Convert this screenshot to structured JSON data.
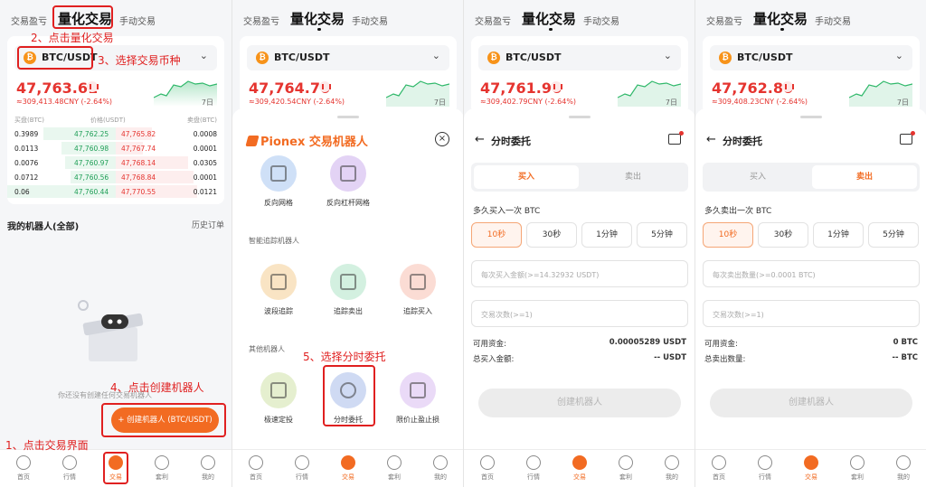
{
  "tabs": {
    "profit": "交易盈亏",
    "quant": "量化交易",
    "manual": "手动交易"
  },
  "pair": "BTC/USDT",
  "coin_symbol": "₿",
  "panels": [
    {
      "price": "47,763.61",
      "sub": "≈309,413.48CNY (-2.64%)"
    },
    {
      "price": "47,764.70",
      "sub": "≈309,420.54CNY (-2.64%)"
    },
    {
      "price": "47,761.96",
      "sub": "≈309,402.79CNY (-2.64%)"
    },
    {
      "price": "47,762.80",
      "sub": "≈309,408.23CNY (-2.64%)"
    }
  ],
  "chart_period": "7日",
  "book": {
    "headers": {
      "buy": "买盘(BTC)",
      "price": "价格(USDT)",
      "sell": "卖盘(BTC)"
    },
    "rows": [
      {
        "bq": "0.3989",
        "bp": "47,762.25",
        "sp": "47,765.82",
        "sq": "0.0008"
      },
      {
        "bq": "0.0113",
        "bp": "47,760.98",
        "sp": "47,767.74",
        "sq": "0.0001"
      },
      {
        "bq": "0.0076",
        "bp": "47,760.97",
        "sp": "47,768.14",
        "sq": "0.0305"
      },
      {
        "bq": "0.0712",
        "bp": "47,760.56",
        "sp": "47,768.84",
        "sq": "0.0001"
      },
      {
        "bq": "0.06",
        "bp": "47,760.44",
        "sp": "47,770.55",
        "sq": "0.0121"
      }
    ]
  },
  "robots": {
    "my": "我的机器人(全部)",
    "history": "历史订单",
    "empty": "你还没有创建任何交易机器人",
    "create": "+ 创建机器人 (BTC/USDT)"
  },
  "nav": [
    "首页",
    "行情",
    "交易",
    "套利",
    "我的"
  ],
  "annotations": {
    "a1": "1、点击交易界面",
    "a2": "2、点击量化交易",
    "a3": "3、选择交易币种",
    "a4": "4、点击创建机器人",
    "a5": "5、选择分时委托"
  },
  "sheet": {
    "brand": "Pionex 交易机器人",
    "bots1": [
      "反向网格",
      "反向杠杆网格"
    ],
    "sec2": "智能追踪机器人",
    "bots2": [
      "波段追踪",
      "追踪卖出",
      "追踪买入"
    ],
    "sec3": "其他机器人",
    "bots3": [
      "极速定投",
      "分时委托",
      "限价止盈止损"
    ]
  },
  "order": {
    "title": "分时委托",
    "buy": "买入",
    "sell": "卖出",
    "buy_label": "多久买入一次 BTC",
    "sell_label": "多久卖出一次 BTC",
    "intervals": [
      "10秒",
      "30秒",
      "1分钟",
      "5分钟"
    ],
    "buy_amount_ph": "每次买入金额(>=14.32932 USDT)",
    "sell_amount_ph": "每次卖出数量(>=0.0001 BTC)",
    "count_ph": "交易次数(>=1)",
    "avail_label": "可用资金:",
    "buy_avail": "0.00005289 USDT",
    "sell_avail": "0 BTC",
    "buy_total_label": "总买入金额:",
    "buy_total": "-- USDT",
    "sell_total_label": "总卖出数量:",
    "sell_total": "-- BTC",
    "create": "创建机器人"
  }
}
